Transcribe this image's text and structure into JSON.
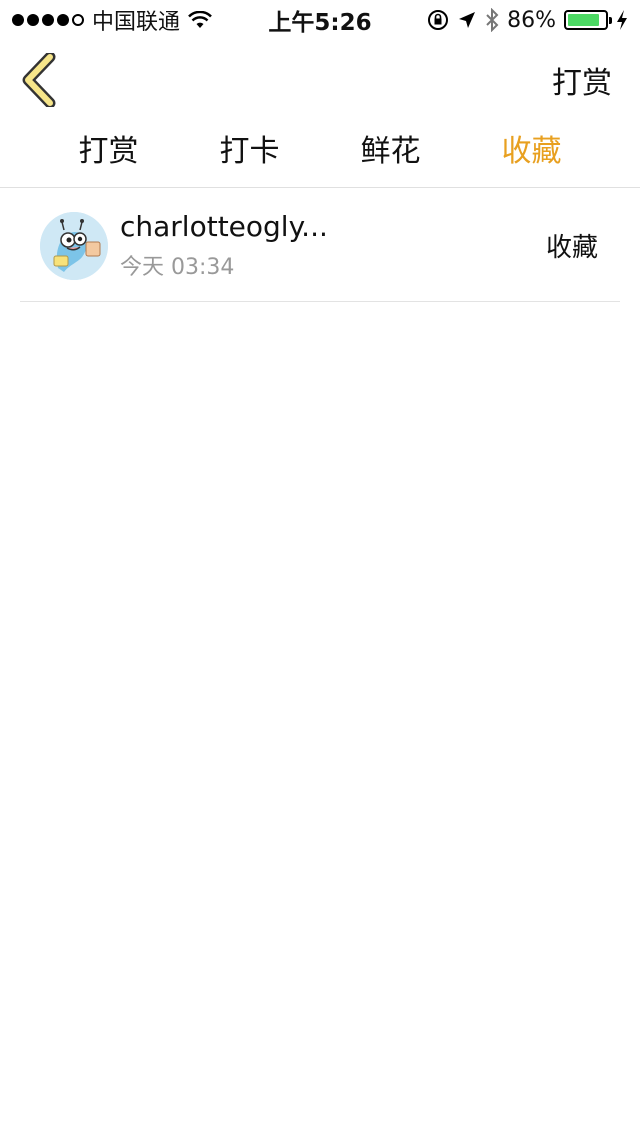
{
  "status_bar": {
    "carrier": "中国联通",
    "time": "上午5:26",
    "battery": "86%",
    "battery_level": 0.86,
    "icons": [
      "signal-dots-icon",
      "wifi-icon",
      "rotation-lock-icon",
      "location-arrow-icon",
      "bluetooth-icon",
      "battery-icon",
      "charging-bolt-icon"
    ]
  },
  "navbar": {
    "back_icon": "chevron-left-icon",
    "action_label": "打赏"
  },
  "tabs": [
    {
      "label": "打赏",
      "active": false
    },
    {
      "label": "打卡",
      "active": false
    },
    {
      "label": "鲜花",
      "active": false
    },
    {
      "label": "收藏",
      "active": true
    }
  ],
  "list": {
    "items": [
      {
        "name": "charlotteogly...",
        "time": "今天 03:34",
        "action": "收藏",
        "avatar": "cartoon-avatar"
      }
    ]
  },
  "colors": {
    "accent": "#e8a020",
    "back_arrow_fill": "#f6e58a",
    "muted_text": "#999999",
    "divider": "#e3e3e3"
  }
}
